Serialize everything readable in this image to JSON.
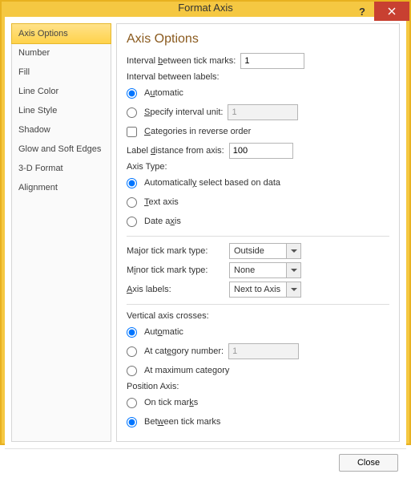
{
  "window": {
    "title": "Format Axis",
    "help": "?",
    "close_button": "Close"
  },
  "sidebar": {
    "items": [
      "Axis Options",
      "Number",
      "Fill",
      "Line Color",
      "Line Style",
      "Shadow",
      "Glow and Soft Edges",
      "3-D Format",
      "Alignment"
    ],
    "selected_index": 0
  },
  "panel": {
    "heading": "Axis Options",
    "interval_tick_label": "Interval between tick marks:",
    "interval_tick_value": "1",
    "interval_labels_label": "Interval between labels:",
    "interval_labels_auto": "Automatic",
    "interval_labels_specify": "Specify interval unit:",
    "interval_labels_specify_value": "1",
    "categories_reverse": "Categories in reverse order",
    "label_distance_label": "Label distance from axis:",
    "label_distance_value": "100",
    "axis_type_label": "Axis Type:",
    "axis_type_auto": "Automatically select based on data",
    "axis_type_text": "Text axis",
    "axis_type_date": "Date axis",
    "major_tick_label": "Major tick mark type:",
    "major_tick_value": "Outside",
    "minor_tick_label": "Minor tick mark type:",
    "minor_tick_value": "None",
    "axis_labels_label": "Axis labels:",
    "axis_labels_value": "Next to Axis",
    "crosses_label": "Vertical axis crosses:",
    "crosses_auto": "Automatic",
    "crosses_cat": "At category number:",
    "crosses_cat_value": "1",
    "crosses_max": "At maximum category",
    "position_label": "Position Axis:",
    "position_on": "On tick marks",
    "position_between": "Between tick marks"
  }
}
